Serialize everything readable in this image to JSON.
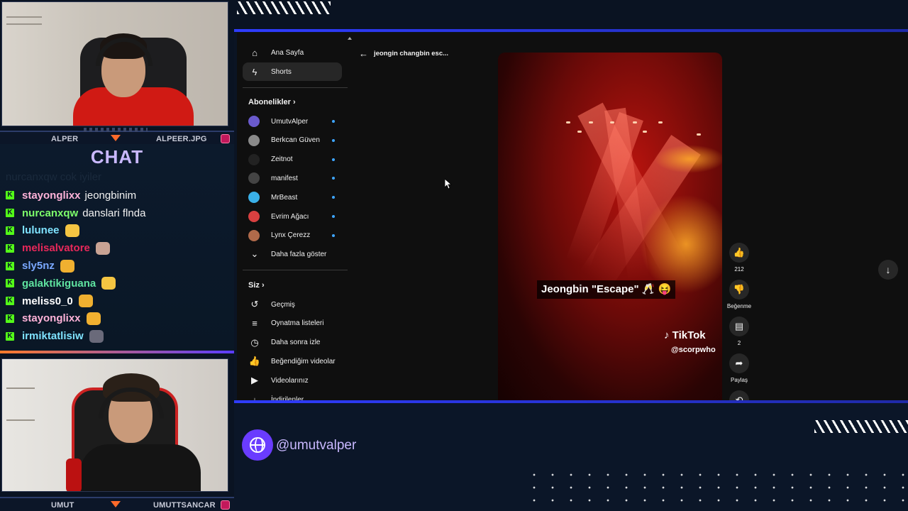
{
  "streamers": {
    "top_cam": {
      "left_name": "ALPER",
      "right_name": "ALPEER.JPG"
    },
    "bottom_cam": {
      "left_name": "UMUT",
      "right_name": "UMUTTSANCAR"
    }
  },
  "chat": {
    "title": "CHAT",
    "faded_message": "nurcanxqw cok iyiler",
    "messages": [
      {
        "user": "stayonglixx",
        "user_color": "#ffb3d9",
        "text": "jeongbinim",
        "emote": ""
      },
      {
        "user": "nurcanxqw",
        "user_color": "#7dff6b",
        "text": "danslari flnda",
        "emote": ""
      },
      {
        "user": "lulunee",
        "user_color": "#7fe3ff",
        "text": "",
        "emote": "#f5c542"
      },
      {
        "user": "melisalvatore",
        "user_color": "#e8285a",
        "text": "",
        "emote": "#c9a394"
      },
      {
        "user": "sly5nz",
        "user_color": "#7aa8ff",
        "text": "",
        "emote": "#f0b030"
      },
      {
        "user": "galaktikiguana",
        "user_color": "#5fe3a0",
        "text": "",
        "emote": "#f5c542"
      },
      {
        "user": "meliss0_0",
        "user_color": "#ffffff",
        "text": "",
        "emote": "#f0b030"
      },
      {
        "user": "stayonglixx",
        "user_color": "#ffb3d9",
        "text": "",
        "emote": "#f0b030"
      },
      {
        "user": "irmiktatlisiw",
        "user_color": "#7fe3ff",
        "text": "",
        "emote": "#6a6a7a"
      }
    ]
  },
  "youtube": {
    "nav": [
      {
        "label": "Ana Sayfa",
        "icon": "home-icon",
        "glyph": "⌂"
      },
      {
        "label": "Shorts",
        "icon": "shorts-icon",
        "glyph": "ϟ"
      }
    ],
    "subscriptions_header": "Abonelikler",
    "subscriptions": [
      {
        "label": "UmutvAlper",
        "color": "#6a5acd"
      },
      {
        "label": "Berkcan Güven",
        "color": "#8a8a8a"
      },
      {
        "label": "Zeitnot",
        "color": "#222222"
      },
      {
        "label": "manifest",
        "color": "#444444"
      },
      {
        "label": "MrBeast",
        "color": "#3ab0e8"
      },
      {
        "label": "Evrim Ağacı",
        "color": "#d94040"
      },
      {
        "label": "Lynx Çerezz",
        "color": "#b06a4a"
      }
    ],
    "show_more": "Daha fazla göster",
    "you_header": "Siz",
    "you_items": [
      {
        "label": "Geçmiş",
        "icon": "history-icon",
        "glyph": "↺"
      },
      {
        "label": "Oynatma listeleri",
        "icon": "playlist-icon",
        "glyph": "≡"
      },
      {
        "label": "Daha sonra izle",
        "icon": "clock-icon",
        "glyph": "◷"
      },
      {
        "label": "Beğendiğim videolar",
        "icon": "like-icon",
        "glyph": "👍"
      },
      {
        "label": "Videolarınız",
        "icon": "video-icon",
        "glyph": "▶"
      },
      {
        "label": "İndirilenler",
        "icon": "download-icon",
        "glyph": "↓"
      }
    ],
    "back_title": "jeongin changbin esc...",
    "video": {
      "caption": "Jeongbin \"Escape\" 🥂 😝",
      "watermark": "TikTok",
      "handle": "@scorpwho"
    },
    "actions": {
      "like_count": "212",
      "dislike_label": "Beğenme",
      "comment_count": "2",
      "share_label": "Paylaş"
    }
  },
  "footer": {
    "social_handle": "@umutvalper"
  },
  "colors": {
    "accent": "#2f3cff",
    "kick_green": "#53fc18",
    "chat_title": "#c9b8ff"
  }
}
